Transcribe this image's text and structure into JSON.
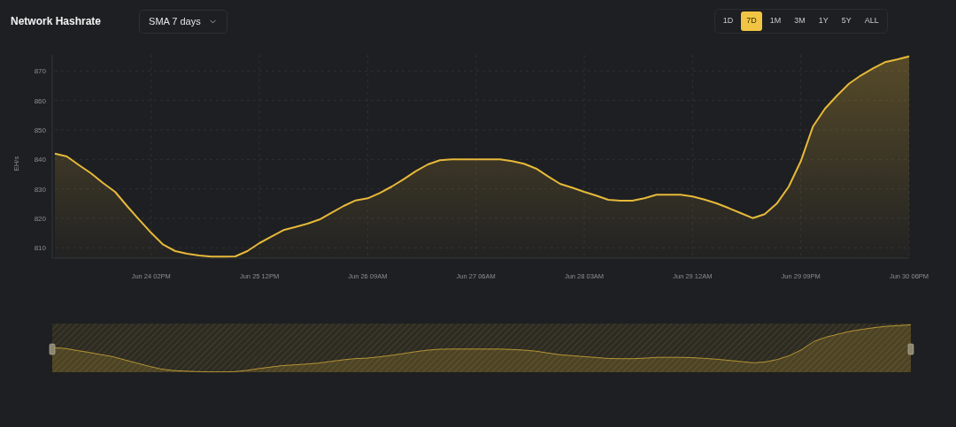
{
  "title": "Network Hashrate",
  "average_select": {
    "value": "SMA 7 days"
  },
  "ranges": [
    {
      "label": "1D",
      "selected": false
    },
    {
      "label": "7D",
      "selected": true
    },
    {
      "label": "1M",
      "selected": false
    },
    {
      "label": "3M",
      "selected": false
    },
    {
      "label": "1Y",
      "selected": false
    },
    {
      "label": "5Y",
      "selected": false
    },
    {
      "label": "ALL",
      "selected": false
    }
  ],
  "chart": {
    "chart_data": {
      "type": "area",
      "ylabel": "EH/s",
      "categories": [
        null,
        null,
        null,
        null,
        null,
        null,
        null,
        null,
        "Jun 24 02PM",
        null,
        null,
        null,
        null,
        null,
        null,
        null,
        null,
        "Jun 25 12PM",
        null,
        null,
        null,
        null,
        null,
        null,
        null,
        null,
        "Jun 26 09AM",
        null,
        null,
        null,
        null,
        null,
        null,
        null,
        null,
        "Jun 27 06AM",
        null,
        null,
        null,
        null,
        null,
        null,
        null,
        null,
        "Jun 28 03AM",
        null,
        null,
        null,
        null,
        null,
        null,
        null,
        null,
        "Jun 29 12AM",
        null,
        null,
        null,
        null,
        null,
        null,
        null,
        null,
        "Jun 29 09PM",
        null,
        null,
        null,
        null,
        null,
        null,
        null,
        null,
        "Jun 30 06PM"
      ],
      "series": [
        {
          "color": "#e6b93a",
          "values": [
            842,
            841,
            838.1,
            835.3,
            832,
            829,
            824.2,
            819.6,
            815.1,
            811.1,
            808.9,
            808,
            807.4,
            807,
            807,
            807.1,
            808.9,
            811.6,
            813.8,
            816,
            817.1,
            818.2,
            819.6,
            821.9,
            824.2,
            826.1,
            826.8,
            828.6,
            830.8,
            833.3,
            836,
            838.3,
            839.7,
            840,
            840,
            840,
            840,
            840,
            839.4,
            838.5,
            836.9,
            834.2,
            831.7,
            830.4,
            829,
            827.7,
            826.3,
            826,
            826,
            826.8,
            828,
            828,
            828,
            827.4,
            826.4,
            825.1,
            823.5,
            821.8,
            820.1,
            821.4,
            825,
            830.8,
            839.4,
            851.1,
            857.2,
            861.6,
            865.7,
            868.5,
            870.9,
            873,
            873.9,
            875
          ]
        }
      ],
      "ylim": [
        806.5,
        875.5
      ],
      "grid": true,
      "yticks": [
        810,
        820,
        830,
        840,
        850,
        860,
        870
      ]
    }
  }
}
